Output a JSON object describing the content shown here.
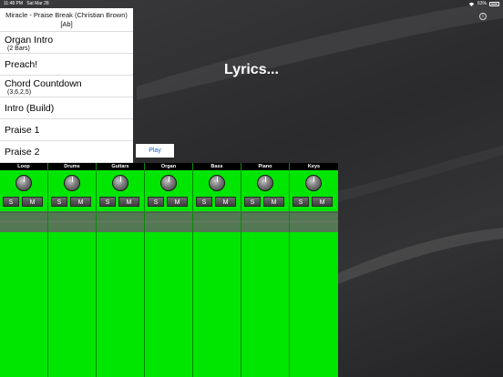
{
  "status_bar": {
    "time": "11:48 PM",
    "date": "Sat Mar 28",
    "battery": "63%"
  },
  "song": {
    "title": "Miracle - Praise Break (Christian Brown) [Ab]",
    "sections": [
      {
        "name": "Organ Intro",
        "note": "(2 Bars)"
      },
      {
        "name": "Preach!",
        "note": ""
      },
      {
        "name": "Chord Countdown",
        "note": "(3,6,2,5)"
      },
      {
        "name": "Intro (Build)",
        "note": ""
      },
      {
        "name": "Praise 1",
        "note": ""
      },
      {
        "name": "Praise 2",
        "note": ""
      }
    ]
  },
  "play_label": "Play",
  "lyrics_text": "Lyrics...",
  "info_label": "i",
  "mixer": {
    "solo_label": "S",
    "mute_label": "M",
    "channels": [
      {
        "name": "Loop"
      },
      {
        "name": "Drums"
      },
      {
        "name": "Guitars"
      },
      {
        "name": "Organ"
      },
      {
        "name": "Bass"
      },
      {
        "name": "Piano"
      },
      {
        "name": "Keys"
      }
    ]
  },
  "colors": {
    "channel_green": "#00e600",
    "play_text": "#1a5fd0"
  }
}
